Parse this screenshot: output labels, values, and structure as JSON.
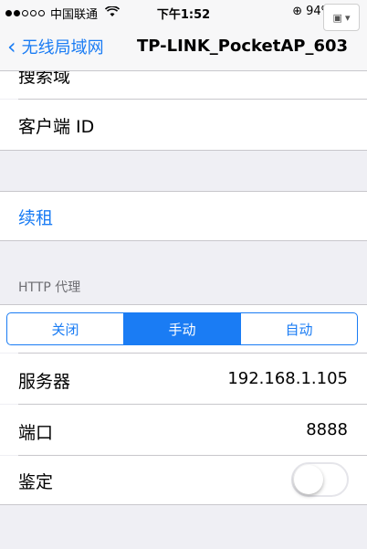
{
  "status_bar": {
    "carrier": "中国联通",
    "time": "下午1:52",
    "battery_text": "94%"
  },
  "nav": {
    "back_label": "无线局域网",
    "title": "TP-LINK_PocketAP_603"
  },
  "ip_settings": {
    "search_domains_label": "搜索域",
    "client_id_label": "客户端 ID"
  },
  "renew_label": "续租",
  "http_proxy": {
    "header": "HTTP 代理",
    "segments": [
      "关闭",
      "手动",
      "自动"
    ],
    "selected": "手动",
    "server_label": "服务器",
    "server_value": "192.168.1.105",
    "port_label": "端口",
    "port_value": "8888",
    "auth_label": "鉴定",
    "auth_enabled": false
  },
  "colors": {
    "accent": "#1a7cf4",
    "background": "#efeff4"
  }
}
